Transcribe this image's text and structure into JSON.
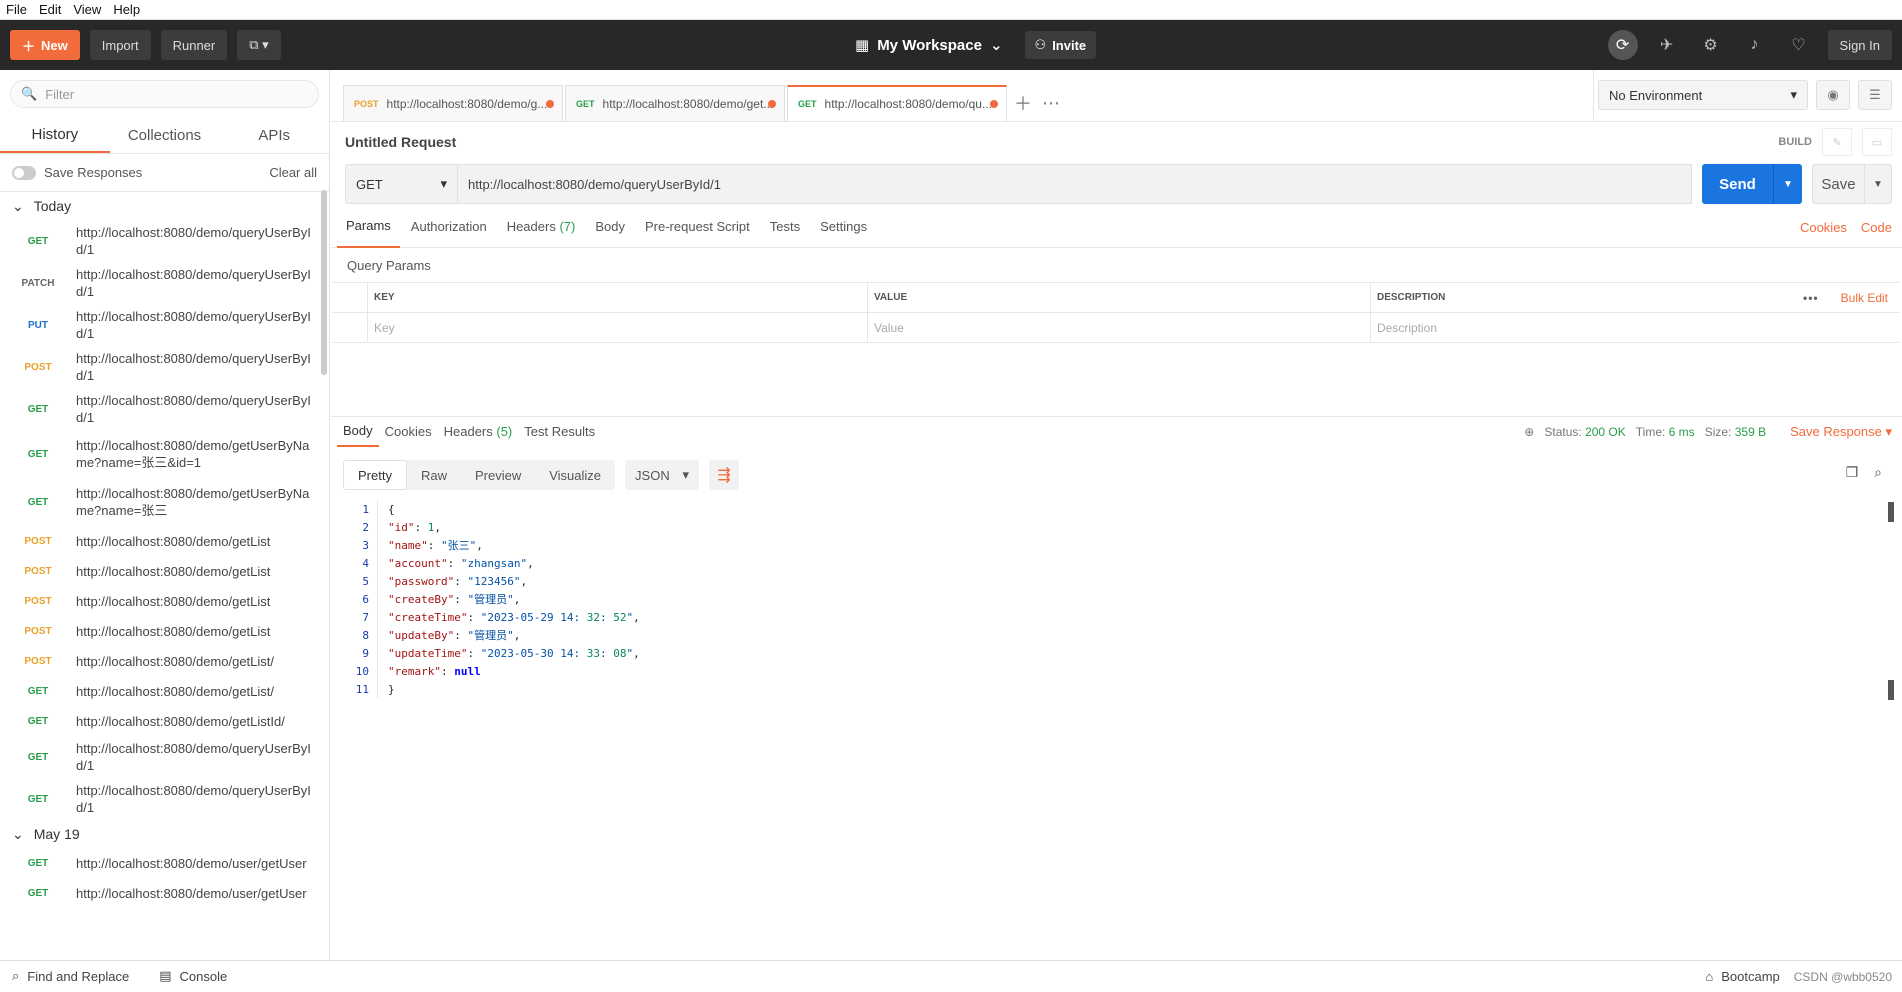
{
  "menu": [
    "File",
    "Edit",
    "View",
    "Help"
  ],
  "topbar": {
    "new_label": "New",
    "import_label": "Import",
    "runner_label": "Runner",
    "workspace": "My Workspace",
    "invite_label": "Invite",
    "signin_label": "Sign In"
  },
  "sidebar": {
    "filter_placeholder": "Filter",
    "tabs": [
      "History",
      "Collections",
      "APIs"
    ],
    "active_tab": "History",
    "save_responses_label": "Save Responses",
    "clear_all_label": "Clear all",
    "groups": [
      {
        "label": "Today",
        "items": [
          {
            "method": "GET",
            "url": "http://localhost:8080/demo/queryUserById/1"
          },
          {
            "method": "PATCH",
            "url": "http://localhost:8080/demo/queryUserById/1"
          },
          {
            "method": "PUT",
            "url": "http://localhost:8080/demo/queryUserById/1"
          },
          {
            "method": "POST",
            "url": "http://localhost:8080/demo/queryUserById/1"
          },
          {
            "method": "GET",
            "url": "http://localhost:8080/demo/queryUserById/1"
          },
          {
            "method": "GET",
            "url": "http://localhost:8080/demo/getUserByName?name=张三&id=1"
          },
          {
            "method": "GET",
            "url": "http://localhost:8080/demo/getUserByName?name=张三"
          },
          {
            "method": "POST",
            "url": "http://localhost:8080/demo/getList"
          },
          {
            "method": "POST",
            "url": "http://localhost:8080/demo/getList"
          },
          {
            "method": "POST",
            "url": "http://localhost:8080/demo/getList"
          },
          {
            "method": "POST",
            "url": "http://localhost:8080/demo/getList"
          },
          {
            "method": "POST",
            "url": "http://localhost:8080/demo/getList/"
          },
          {
            "method": "GET",
            "url": "http://localhost:8080/demo/getList/"
          },
          {
            "method": "GET",
            "url": "http://localhost:8080/demo/getListId/"
          },
          {
            "method": "GET",
            "url": "http://localhost:8080/demo/queryUserById/1"
          },
          {
            "method": "GET",
            "url": "http://localhost:8080/demo/queryUserById/1"
          }
        ]
      },
      {
        "label": "May 19",
        "items": [
          {
            "method": "GET",
            "url": "http://localhost:8080/demo/user/getUser"
          },
          {
            "method": "GET",
            "url": "http://localhost:8080/demo/user/getUser"
          }
        ]
      }
    ]
  },
  "tabs": [
    {
      "method": "POST",
      "label": "http://localhost:8080/demo/g...",
      "active": false
    },
    {
      "method": "GET",
      "label": "http://localhost:8080/demo/get...",
      "active": false
    },
    {
      "method": "GET",
      "label": "http://localhost:8080/demo/qu...",
      "active": true
    }
  ],
  "environment": "No Environment",
  "request": {
    "title": "Untitled Request",
    "build_label": "BUILD",
    "method": "GET",
    "url": "http://localhost:8080/demo/queryUserById/1",
    "send_label": "Send",
    "save_label": "Save",
    "tabs": [
      "Params",
      "Authorization",
      "Headers",
      "Body",
      "Pre-request Script",
      "Tests",
      "Settings"
    ],
    "headers_count": "(7)",
    "cookies_label": "Cookies",
    "code_label": "Code",
    "query_params_title": "Query Params",
    "columns": [
      "KEY",
      "VALUE",
      "DESCRIPTION"
    ],
    "bulk_edit_label": "Bulk Edit",
    "placeholders": {
      "key": "Key",
      "value": "Value",
      "description": "Description"
    }
  },
  "response": {
    "tabs": [
      "Body",
      "Cookies",
      "Headers",
      "Test Results"
    ],
    "headers_count": "(5)",
    "status_label": "Status:",
    "status_value": "200 OK",
    "time_label": "Time:",
    "time_value": "6 ms",
    "size_label": "Size:",
    "size_value": "359 B",
    "save_response_label": "Save Response",
    "views": [
      "Pretty",
      "Raw",
      "Preview",
      "Visualize"
    ],
    "format": "JSON",
    "body_lines": [
      "{",
      "    \"id\": 1,",
      "    \"name\": \"张三\",",
      "    \"account\": \"zhangsan\",",
      "    \"password\": \"123456\",",
      "    \"createBy\": \"管理员\",",
      "    \"createTime\": \"2023-05-29 14:32:52\",",
      "    \"updateBy\": \"管理员\",",
      "    \"updateTime\": \"2023-05-30 14:33:08\",",
      "    \"remark\": null",
      "}"
    ]
  },
  "statusbar": {
    "find_replace": "Find and Replace",
    "console": "Console",
    "bootcamp": "Bootcamp",
    "watermark": "CSDN @wbb0520"
  }
}
